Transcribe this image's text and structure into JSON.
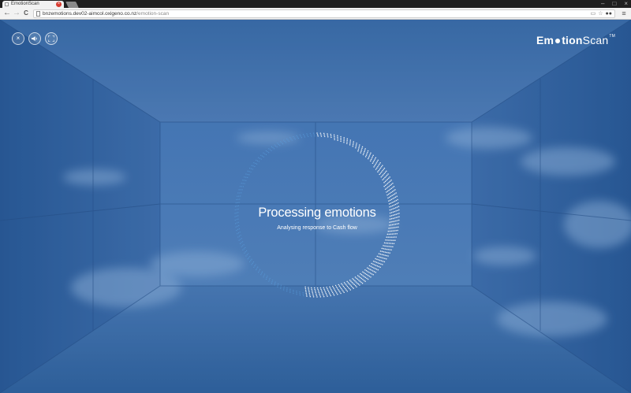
{
  "browser": {
    "tab_title": "EmotionScan",
    "tab_close": "×",
    "url_host": "bnzemotions.dev02-aimcol.oxigeno.co.nz",
    "url_path": "/emotion-scan",
    "back_icon": "←",
    "forward_icon": "→",
    "reload_icon": "C",
    "menu_icon": "≡",
    "window_controls": [
      "–",
      "□",
      "×"
    ]
  },
  "controls": {
    "close_icon": "×"
  },
  "logo": {
    "part1": "Em",
    "part2": "tion",
    "part3": "Scan",
    "tm": "TM"
  },
  "status": {
    "title": "Processing emotions",
    "subtitle": "Analysing response to Cash flow",
    "progress": 0.52
  },
  "colors": {
    "background": "#2f5f9c",
    "ring_done": "#ffffff",
    "ring_remaining": "#5aa0e0"
  }
}
